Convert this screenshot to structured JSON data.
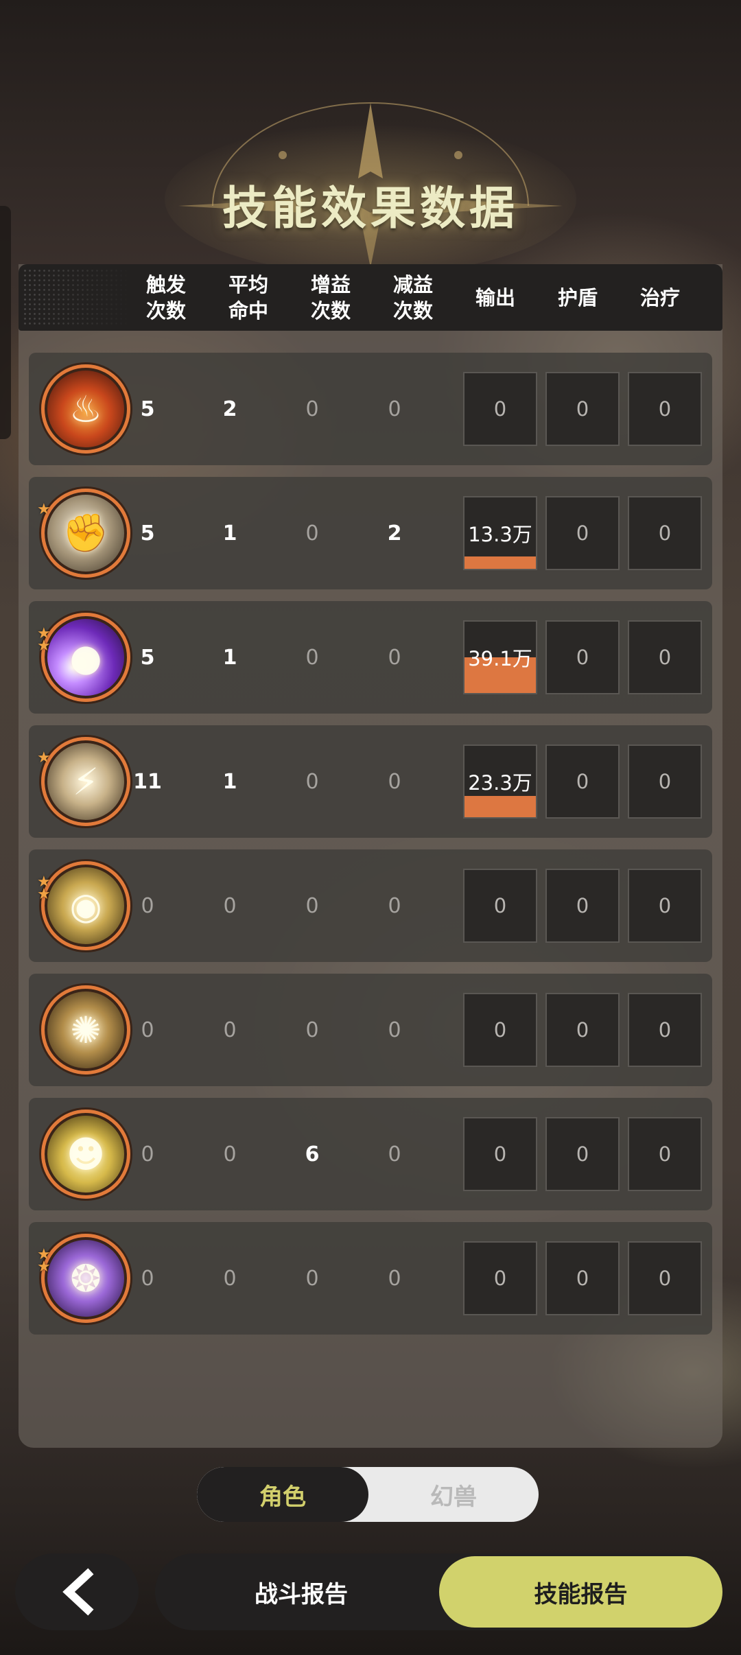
{
  "title": "技能效果数据",
  "columns": [
    {
      "label": "触发\n次数"
    },
    {
      "label": "平均\n命中"
    },
    {
      "label": "增益\n次数"
    },
    {
      "label": "减益\n次数"
    },
    {
      "label": "输出"
    },
    {
      "label": "护盾"
    },
    {
      "label": "治疗"
    }
  ],
  "rows": [
    {
      "icon": "fire-skill-icon",
      "stars": 0,
      "trigger": "5",
      "avg_hit": "2",
      "buff": "0",
      "debuff": "0",
      "output": "0",
      "output_fill": 0,
      "shield": "0",
      "heal": "0"
    },
    {
      "icon": "strike-skill-icon",
      "stars": 1,
      "trigger": "5",
      "avg_hit": "1",
      "buff": "0",
      "debuff": "2",
      "output": "13.3万",
      "output_fill": 0.17,
      "shield": "0",
      "heal": "0"
    },
    {
      "icon": "purple-orb-skill-icon",
      "stars": 2,
      "trigger": "5",
      "avg_hit": "1",
      "buff": "0",
      "debuff": "0",
      "output": "39.1万",
      "output_fill": 0.5,
      "shield": "0",
      "heal": "0"
    },
    {
      "icon": "slash-skill-icon",
      "stars": 1,
      "trigger": "11",
      "avg_hit": "1",
      "buff": "0",
      "debuff": "0",
      "output": "23.3万",
      "output_fill": 0.3,
      "shield": "0",
      "heal": "0"
    },
    {
      "icon": "eye-skill-icon",
      "stars": 2,
      "trigger": "0",
      "avg_hit": "0",
      "buff": "0",
      "debuff": "0",
      "output": "0",
      "output_fill": 0,
      "shield": "0",
      "heal": "0"
    },
    {
      "icon": "vortex-skill-icon",
      "stars": 0,
      "trigger": "0",
      "avg_hit": "0",
      "buff": "0",
      "debuff": "0",
      "output": "0",
      "output_fill": 0,
      "shield": "0",
      "heal": "0"
    },
    {
      "icon": "spirit-skill-icon",
      "stars": 0,
      "trigger": "0",
      "avg_hit": "0",
      "buff": "6",
      "debuff": "0",
      "output": "0",
      "output_fill": 0,
      "shield": "0",
      "heal": "0"
    },
    {
      "icon": "lightning-orb-skill-icon",
      "stars": 2,
      "trigger": "0",
      "avg_hit": "0",
      "buff": "0",
      "debuff": "0",
      "output": "0",
      "output_fill": 0,
      "shield": "0",
      "heal": "0"
    }
  ],
  "toggle": {
    "active": "角色",
    "inactive": "幻兽"
  },
  "bottom": {
    "back_icon": "chevron-left-icon",
    "battle_report": "战斗报告",
    "skill_report": "技能报告"
  },
  "colors": {
    "accent": "#d1d26c",
    "bar_fill": "#dd7741",
    "icon_ring": "#e27a3a"
  }
}
